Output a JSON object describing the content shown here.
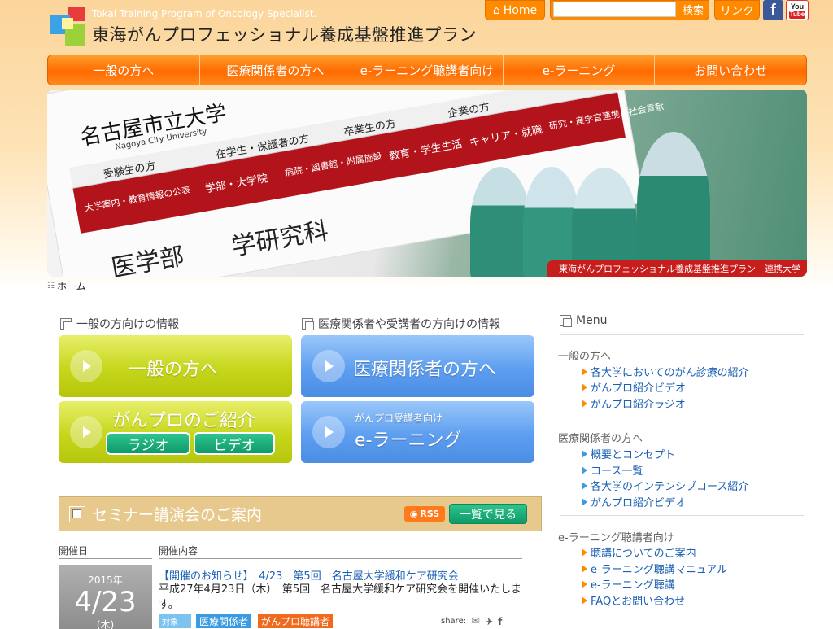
{
  "header": {
    "tagline": "Tokai Training Program of Oncology Specialist.",
    "title": "東海がんプロフェッショナル養成基盤推進プラン",
    "home_label": "Home",
    "search_placeholder": "",
    "search_label": "検索",
    "link_label": "リンク",
    "facebook": "f",
    "youtube_top": "You",
    "youtube_bottom": "Tube"
  },
  "nav": [
    "一般の方へ",
    "医療関係者の方へ",
    "e-ラーニング聴講者向け",
    "e-ラーニング",
    "お問い合わせ"
  ],
  "hero": {
    "sign_title": "名古屋市立大学",
    "sign_en": "Nagoya City University",
    "sign_gray": [
      "受験生の方",
      "在学生・保護者の方",
      "卒業生の方",
      "企業の方"
    ],
    "sign_red": [
      "大学案内・教育情報の公表",
      "学部・大学院",
      "病院・図書館・附属施設",
      "教育・学生生活",
      "キャリア・就職",
      "研究・産学官連携・社会貢献"
    ],
    "sign_big": "医学部　　学研究科",
    "caption": "東海がんプロフェッショナル養成基盤推進プラン　連携大学"
  },
  "breadcrumb": "ホーム",
  "sections": {
    "general_heading": "一般の方向けの情報",
    "medical_heading": "医療関係者や受講者の方向けの情報"
  },
  "buttons": {
    "general": "一般の方へ",
    "medical": "医療関係者の方へ",
    "intro": "がんプロのご紹介",
    "radio": "ラジオ",
    "video": "ビデオ",
    "elearn_small": "がんプロ受講者向け",
    "elearn": "e-ラーニング"
  },
  "seminar": {
    "title": "セミナー講演会のご案内",
    "rss": "RSS",
    "list_button": "一覧で見る",
    "col_date": "開催日",
    "col_content": "開催内容",
    "event": {
      "year": "2015年",
      "date": "4/23",
      "weekday": "(木)",
      "link": "【開催のお知らせ】　4/23　第5回　名古屋大学緩和ケア研究会",
      "text": "平成27年4月23日（木）　第5回　名古屋大学緩和ケア研究会を開催いたします。",
      "target_label": "対象",
      "tags": [
        "医療関係者",
        "がんプロ聴講者"
      ],
      "share": "share:"
    }
  },
  "sidebar": {
    "heading": "Menu",
    "groups": [
      {
        "title": "一般の方へ",
        "items": [
          "各大学においてのがん診療の紹介",
          "がんプロ紹介ビデオ",
          "がんプロ紹介ラジオ"
        ]
      },
      {
        "title": "医療関係者の方へ",
        "items": [
          "概要とコンセプト",
          "コース一覧",
          "各大学のインテンシブコース紹介",
          "がんプロ紹介ビデオ"
        ]
      },
      {
        "title": "e-ラーニング聴講者向け",
        "items": [
          "聴講についてのご案内",
          "e-ラーニング聴講マニュアル",
          "e-ラーニング聴講",
          "FAQとお問い合わせ"
        ]
      }
    ]
  },
  "colors": {
    "brand_orange": "#ff8a00",
    "nav_orange": "#ff6a00",
    "link_blue": "#1a5fb4",
    "button_green": "#c6d61b",
    "button_blue": "#5d9ef0"
  }
}
